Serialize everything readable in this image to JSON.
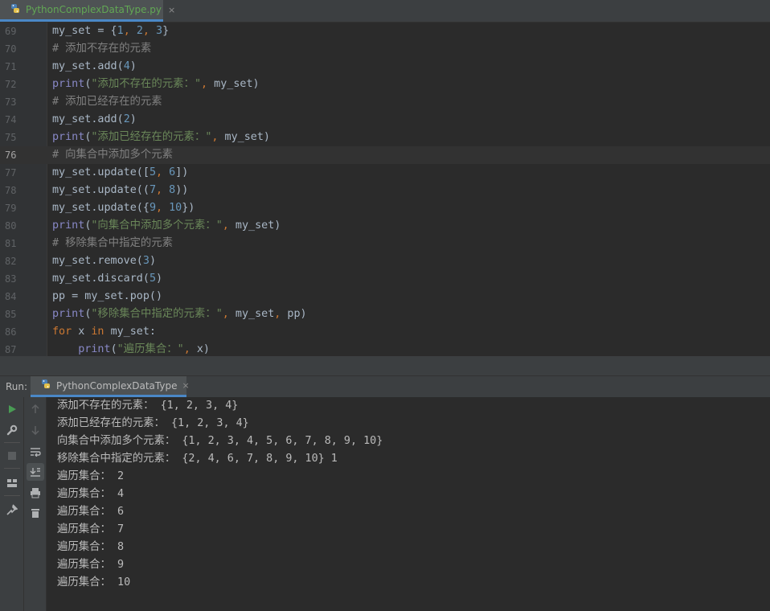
{
  "editor_tab": {
    "filename": "PythonComplexDataType.py",
    "close": "×",
    "icon": "python-file-icon"
  },
  "editor": {
    "current_line": 76,
    "lines": [
      {
        "no": "69",
        "tokens": [
          [
            "p",
            "my_set = {"
          ],
          [
            "n",
            "1"
          ],
          [
            "k",
            ", "
          ],
          [
            "n",
            "2"
          ],
          [
            "k",
            ", "
          ],
          [
            "n",
            "3"
          ],
          [
            "p",
            "}"
          ]
        ]
      },
      {
        "no": "70",
        "tokens": [
          [
            "c",
            "# 添加不存在的元素"
          ]
        ]
      },
      {
        "no": "71",
        "tokens": [
          [
            "p",
            "my_set.add("
          ],
          [
            "n",
            "4"
          ],
          [
            "p",
            ")"
          ]
        ]
      },
      {
        "no": "72",
        "tokens": [
          [
            "f",
            "print"
          ],
          [
            "p",
            "("
          ],
          [
            "s",
            "\"添加不存在的元素：\""
          ],
          [
            "k",
            ", "
          ],
          [
            "p",
            "my_set)"
          ]
        ]
      },
      {
        "no": "73",
        "tokens": [
          [
            "c",
            "# 添加已经存在的元素"
          ]
        ]
      },
      {
        "no": "74",
        "tokens": [
          [
            "p",
            "my_set.add("
          ],
          [
            "n",
            "2"
          ],
          [
            "p",
            ")"
          ]
        ]
      },
      {
        "no": "75",
        "tokens": [
          [
            "f",
            "print"
          ],
          [
            "p",
            "("
          ],
          [
            "s",
            "\"添加已经存在的元素：\""
          ],
          [
            "k",
            ", "
          ],
          [
            "p",
            "my_set)"
          ]
        ]
      },
      {
        "no": "76",
        "tokens": [
          [
            "c",
            "# 向集合中添加多个元素"
          ]
        ]
      },
      {
        "no": "77",
        "tokens": [
          [
            "p",
            "my_set.update(["
          ],
          [
            "n",
            "5"
          ],
          [
            "k",
            ", "
          ],
          [
            "n",
            "6"
          ],
          [
            "p",
            "])"
          ]
        ]
      },
      {
        "no": "78",
        "tokens": [
          [
            "p",
            "my_set.update(("
          ],
          [
            "n",
            "7"
          ],
          [
            "k",
            ", "
          ],
          [
            "n",
            "8"
          ],
          [
            "p",
            "))"
          ]
        ]
      },
      {
        "no": "79",
        "tokens": [
          [
            "p",
            "my_set.update({"
          ],
          [
            "n",
            "9"
          ],
          [
            "k",
            ", "
          ],
          [
            "n",
            "10"
          ],
          [
            "p",
            "})"
          ]
        ]
      },
      {
        "no": "80",
        "tokens": [
          [
            "f",
            "print"
          ],
          [
            "p",
            "("
          ],
          [
            "s",
            "\"向集合中添加多个元素：\""
          ],
          [
            "k",
            ", "
          ],
          [
            "p",
            "my_set)"
          ]
        ]
      },
      {
        "no": "81",
        "tokens": [
          [
            "c",
            "# 移除集合中指定的元素"
          ]
        ]
      },
      {
        "no": "82",
        "tokens": [
          [
            "p",
            "my_set.remove("
          ],
          [
            "n",
            "3"
          ],
          [
            "p",
            ")"
          ]
        ]
      },
      {
        "no": "83",
        "tokens": [
          [
            "p",
            "my_set.discard("
          ],
          [
            "n",
            "5"
          ],
          [
            "p",
            ")"
          ]
        ]
      },
      {
        "no": "84",
        "tokens": [
          [
            "p",
            "pp = my_set.pop()"
          ]
        ]
      },
      {
        "no": "85",
        "tokens": [
          [
            "f",
            "print"
          ],
          [
            "p",
            "("
          ],
          [
            "s",
            "\"移除集合中指定的元素：\""
          ],
          [
            "k",
            ", "
          ],
          [
            "p",
            "my_set"
          ],
          [
            "k",
            ", "
          ],
          [
            "p",
            "pp)"
          ]
        ]
      },
      {
        "no": "86",
        "tokens": [
          [
            "k",
            "for "
          ],
          [
            "p",
            "x "
          ],
          [
            "k",
            "in "
          ],
          [
            "p",
            "my_set:"
          ]
        ]
      },
      {
        "no": "87",
        "tokens": [
          [
            "p",
            "    "
          ],
          [
            "f",
            "print"
          ],
          [
            "p",
            "("
          ],
          [
            "s",
            "\"遍历集合：\""
          ],
          [
            "k",
            ", "
          ],
          [
            "p",
            "x)"
          ]
        ]
      }
    ]
  },
  "run_panel": {
    "label": "Run:",
    "tab_label": "PythonComplexDataType",
    "tab_close": "×",
    "output": [
      "添加不存在的元素： {1, 2, 3, 4}",
      "添加已经存在的元素： {1, 2, 3, 4}",
      "向集合中添加多个元素： {1, 2, 3, 4, 5, 6, 7, 8, 9, 10}",
      "移除集合中指定的元素： {2, 4, 6, 7, 8, 9, 10} 1",
      "遍历集合： 2",
      "遍历集合： 4",
      "遍历集合： 6",
      "遍历集合： 7",
      "遍历集合： 8",
      "遍历集合： 9",
      "遍历集合： 10"
    ]
  },
  "colors": {
    "keyword": "#cc7832",
    "number": "#6897bb",
    "string": "#6a8759",
    "comment": "#808080",
    "builtin": "#8888c6",
    "accent": "#4a88c7",
    "run_green": "#499c54"
  }
}
